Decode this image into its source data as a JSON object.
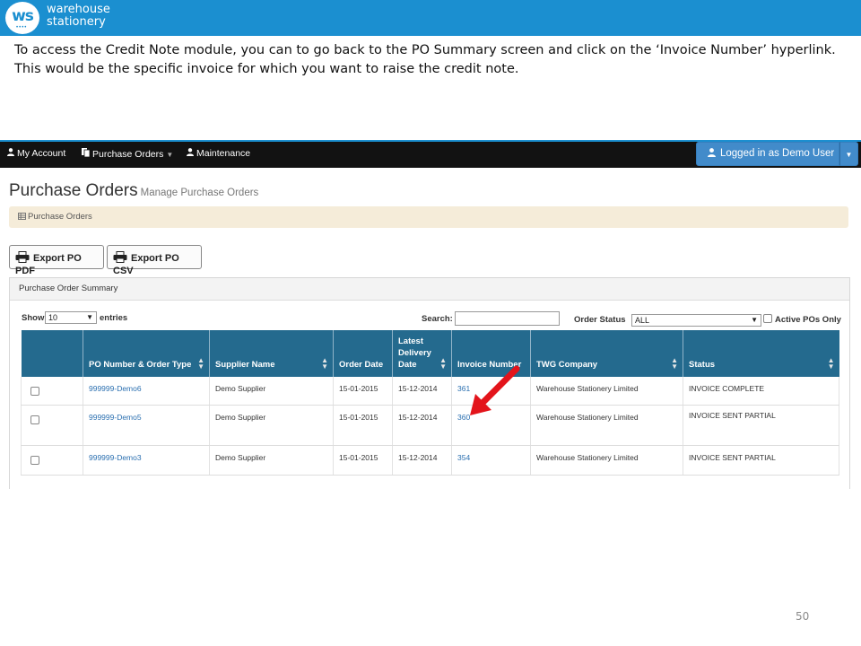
{
  "brand": {
    "logo_text": "ws",
    "name_line1": "warehouse",
    "name_line2": "stationery"
  },
  "instruction": "To access the Credit Note module, you can to go back to the PO Summary screen and click on the ‘Invoice Number’ hyperlink. This would be the specific invoice for which you want to raise the credit note.",
  "nav": {
    "items": [
      {
        "icon": "user-icon",
        "label": "My Account"
      },
      {
        "icon": "document-icon",
        "label": "Purchase Orders"
      },
      {
        "icon": "user-icon",
        "label": "Maintenance"
      }
    ],
    "logged_in_label": "Logged in as Demo User"
  },
  "page": {
    "title": "Purchase Orders",
    "subtitle": "Manage Purchase Orders",
    "breadcrumb": "Purchase Orders"
  },
  "buttons": {
    "export_pdf": "Export PO PDF",
    "export_csv": "Export PO CSV"
  },
  "panel": {
    "title": "Purchase Order Summary",
    "show_label": "Show",
    "entries_value": "10",
    "entries_label": "entries",
    "search_label": "Search:",
    "search_value": "",
    "order_status_label": "Order Status",
    "order_status_value": "ALL",
    "active_pos_label": "Active POs Only"
  },
  "table": {
    "headers": [
      "",
      "PO Number & Order Type",
      "Supplier Name",
      "Order Date",
      "Latest Delivery Date",
      "Invoice Number",
      "TWG Company",
      "Status"
    ],
    "rows": [
      {
        "po": "999999-Demo6",
        "supplier": "Demo Supplier",
        "order_date": "15-01-2015",
        "delivery_date": "15-12-2014",
        "invoice": "361",
        "company": "Warehouse Stationery Limited",
        "status": "INVOICE COMPLETE"
      },
      {
        "po": "999999-Demo5",
        "supplier": "Demo Supplier",
        "order_date": "15-01-2015",
        "delivery_date": "15-12-2014",
        "invoice": "360",
        "company": "Warehouse Stationery Limited",
        "status": "INVOICE SENT PARTIAL"
      },
      {
        "po": "999999-Demo3",
        "supplier": "Demo Supplier",
        "order_date": "15-01-2015",
        "delivery_date": "15-12-2014",
        "invoice": "354",
        "company": "Warehouse Stationery Limited",
        "status": "INVOICE SENT PARTIAL"
      }
    ]
  },
  "annotation": {
    "icon": "red-arrow-icon",
    "color": "#e3141b"
  },
  "colors": {
    "brand_blue": "#1b8fd0",
    "table_header": "#246a8e",
    "link": "#2a6fb0",
    "navbar": "#121212",
    "primary_button": "#428bca"
  },
  "slide_number": "50"
}
